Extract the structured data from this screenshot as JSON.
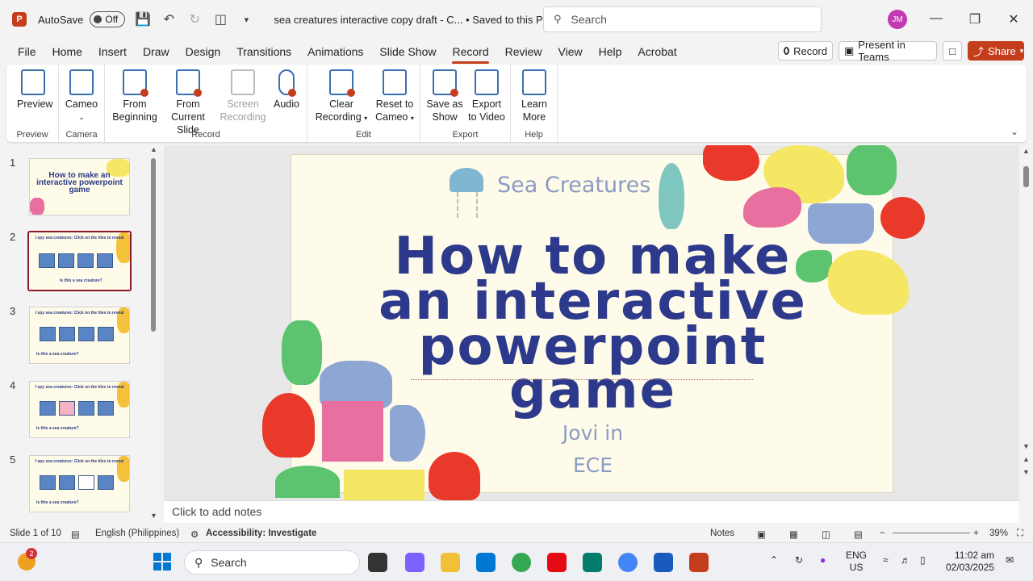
{
  "titlebar": {
    "app_icon": "P",
    "autosave_label": "AutoSave",
    "autosave_state": "Off",
    "doc_title": "sea creatures interactive copy draft - C... • Saved to this PC",
    "search_placeholder": "Search",
    "avatar_initials": "JM"
  },
  "menu": {
    "tabs": [
      "File",
      "Home",
      "Insert",
      "Draw",
      "Design",
      "Transitions",
      "Animations",
      "Slide Show",
      "Record",
      "Review",
      "View",
      "Help",
      "Acrobat"
    ],
    "active": "Record",
    "record_button": "Record",
    "present_button": "Present in Teams",
    "share_button": "Share"
  },
  "ribbon": {
    "preview": {
      "cmd": "Preview",
      "group": "Preview"
    },
    "camera": {
      "cmd": "Cameo",
      "group": "Camera"
    },
    "record": {
      "from_beginning_1": "From",
      "from_beginning_2": "Beginning",
      "from_current_1": "From",
      "from_current_2": "Current Slide",
      "screen_1": "Screen",
      "screen_2": "Recording",
      "audio": "Audio",
      "group": "Record"
    },
    "edit": {
      "clear_1": "Clear",
      "clear_2": "Recording",
      "reset_1": "Reset to",
      "reset_2": "Cameo",
      "group": "Edit"
    },
    "export": {
      "save_1": "Save as",
      "save_2": "Show",
      "export_1": "Export",
      "export_2": "to Video",
      "group": "Export"
    },
    "help": {
      "learn_1": "Learn",
      "learn_2": "More",
      "group": "Help"
    }
  },
  "thumbnails": [
    {
      "num": "1",
      "title": "How to make an interactive powerpoint game"
    },
    {
      "num": "2",
      "title": "I spy sea creatures: Click on the tiles to reveal",
      "footer": "Is this a sea creature?"
    },
    {
      "num": "3",
      "title": "I spy sea creatures: Click on the tiles to reveal",
      "footer": "Is this a sea creature?"
    },
    {
      "num": "4",
      "title": "I spy sea creatures: Click on the tiles to reveal",
      "footer": "Is this a sea creature?"
    },
    {
      "num": "5",
      "title": "I spy sea creatures: Click on the tiles to reveal",
      "footer": "Is this a sea creature?"
    }
  ],
  "slide": {
    "brand": "Sea Creatures",
    "title_line1": "How to make",
    "title_line2": "an interactive",
    "title_line3": "powerpoint",
    "title_line4": "game",
    "author_line1": "Jovi in",
    "author_line2": "ECE"
  },
  "notes_placeholder": "Click to add notes",
  "status": {
    "slide_count": "Slide 1 of 10",
    "language": "English (Philippines)",
    "accessibility": "Accessibility: Investigate",
    "notes": "Notes",
    "zoom": "39%"
  },
  "taskbar": {
    "search": "Search",
    "badge": "2",
    "lang_1": "ENG",
    "lang_2": "US",
    "time": "11:02 am",
    "date": "02/03/2025"
  },
  "colors": {
    "accent": "#c43e1c",
    "title_blue": "#2d3a8c",
    "slide_bg": "#fffbea"
  }
}
